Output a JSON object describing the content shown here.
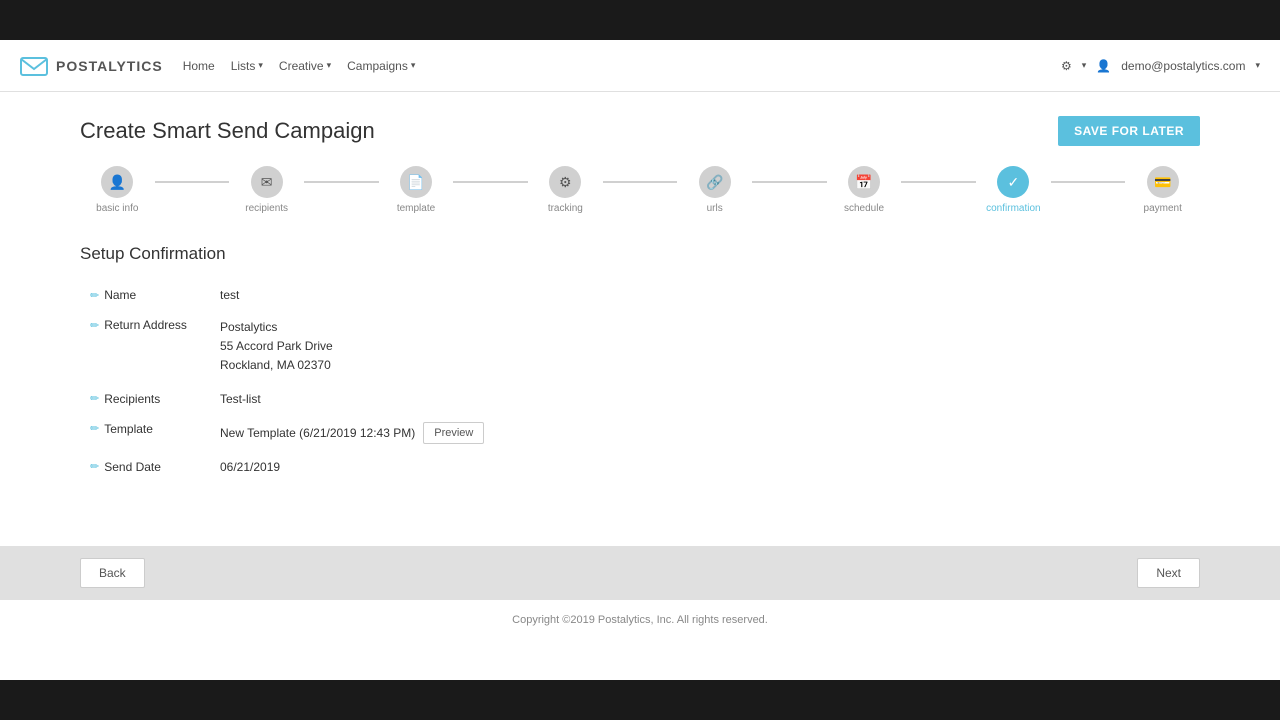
{
  "topbar": {},
  "navbar": {
    "brand": "POSTALYTICS",
    "nav_items": [
      {
        "label": "Home",
        "has_dropdown": false
      },
      {
        "label": "Lists",
        "has_dropdown": true
      },
      {
        "label": "Creative",
        "has_dropdown": true
      },
      {
        "label": "Campaigns",
        "has_dropdown": true
      }
    ],
    "user_menu": {
      "settings_icon": "gear",
      "user_email": "demo@postalytics.com"
    }
  },
  "page": {
    "title": "Create Smart Send Campaign",
    "save_later_label": "SAVE FOR LATER"
  },
  "steps": [
    {
      "id": "basic_info",
      "label": "basic info",
      "state": "completed",
      "icon": "👤"
    },
    {
      "id": "recipients",
      "label": "recipients",
      "state": "completed",
      "icon": "✉"
    },
    {
      "id": "template",
      "label": "template",
      "state": "completed",
      "icon": "📄"
    },
    {
      "id": "tracking",
      "label": "tracking",
      "state": "completed",
      "icon": "⚙"
    },
    {
      "id": "urls",
      "label": "urls",
      "state": "completed",
      "icon": "🔗"
    },
    {
      "id": "schedule",
      "label": "schedule",
      "state": "completed",
      "icon": "📅"
    },
    {
      "id": "confirmation",
      "label": "confirmation",
      "state": "active",
      "icon": "✓"
    },
    {
      "id": "payment",
      "label": "payment",
      "state": "inactive",
      "icon": "💳"
    }
  ],
  "section": {
    "title": "Setup Confirmation",
    "fields": [
      {
        "label": "Name",
        "value": "test",
        "has_edit": true,
        "type": "text"
      },
      {
        "label": "Return Address",
        "value_lines": [
          "Postalytics",
          "55 Accord Park Drive",
          "Rockland, MA 02370"
        ],
        "has_edit": true,
        "type": "address"
      },
      {
        "label": "Recipients",
        "value": "Test-list",
        "has_edit": true,
        "type": "text"
      },
      {
        "label": "Template",
        "value": "New Template (6/21/2019 12:43 PM)",
        "has_preview": true,
        "preview_label": "Preview",
        "has_edit": true,
        "type": "template"
      },
      {
        "label": "Send Date",
        "value": "06/21/2019",
        "has_edit": true,
        "type": "text"
      }
    ]
  },
  "bottom_bar": {
    "back_label": "Back",
    "next_label": "Next"
  },
  "footer": {
    "text": "Copyright ©2019 Postalytics, Inc. All rights reserved."
  }
}
